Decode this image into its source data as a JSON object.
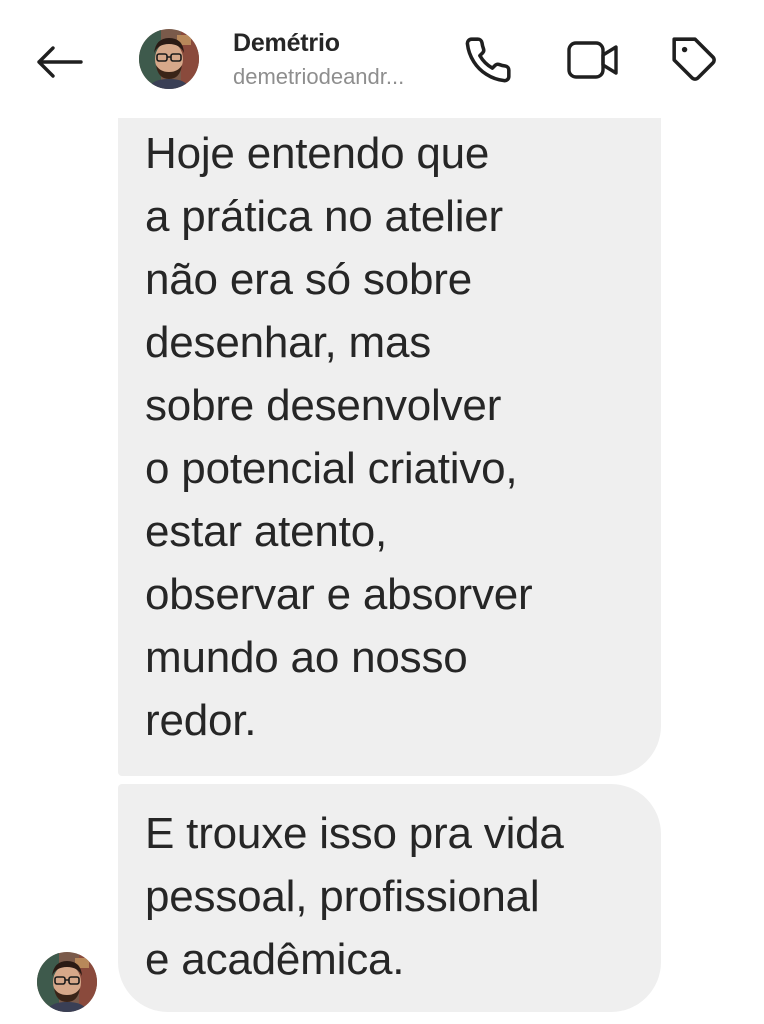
{
  "header": {
    "contact_name": "Demétrio",
    "contact_handle": "demetriodeandr...",
    "back_icon": "arrow-left-icon",
    "actions": [
      {
        "name": "voice-call",
        "icon": "phone-icon"
      },
      {
        "name": "video-call",
        "icon": "video-camera-icon"
      },
      {
        "name": "tag",
        "icon": "tag-icon"
      }
    ]
  },
  "messages": [
    {
      "sender": "Demétrio",
      "text": "Hoje entendo que\na prática no atelier\nnão era só sobre\ndesenhar, mas\nsobre desenvolver\no potencial criativo,\nestar atento,\nobservar e absorver\nmundo ao nosso\nredor."
    },
    {
      "sender": "Demétrio",
      "text": "E trouxe isso pra vida\npessoal, profissional\ne acadêmica."
    }
  ],
  "colors": {
    "background": "#ffffff",
    "bubble_incoming": "#efefef",
    "text_primary": "#262626",
    "text_secondary": "#8e8e8e",
    "icon": "#1f1f1f"
  }
}
